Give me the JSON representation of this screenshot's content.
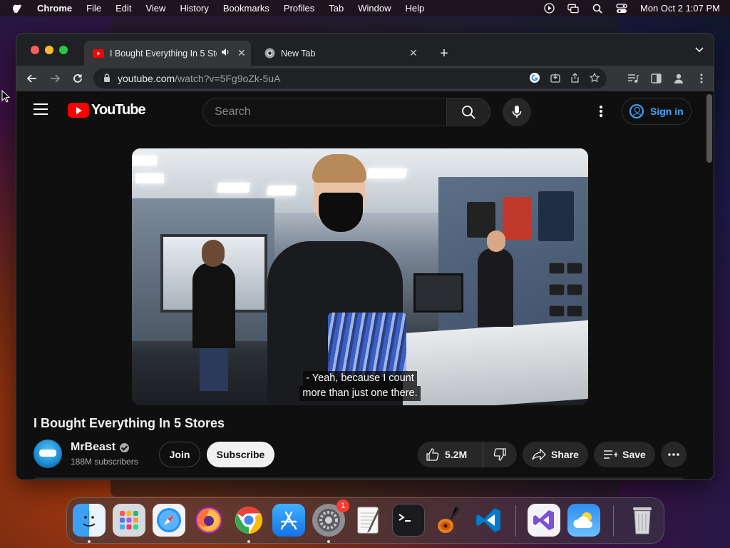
{
  "menubar": {
    "app_name": "Chrome",
    "items": [
      "File",
      "Edit",
      "View",
      "History",
      "Bookmarks",
      "Profiles",
      "Tab",
      "Window",
      "Help"
    ],
    "clock": "Mon Oct 2  1:07 PM"
  },
  "browser": {
    "tabs": [
      {
        "title": "I Bought Everything In 5 Sto",
        "favicon": "youtube-icon",
        "active": true
      },
      {
        "title": "New Tab",
        "favicon": "chrome-icon",
        "active": false
      }
    ],
    "url_host": "youtube.com",
    "url_path": "/watch?v=5Fg9oZk-5uA"
  },
  "youtube": {
    "logo_text": "YouTube",
    "search_placeholder": "Search",
    "sign_in_label": "Sign in",
    "caption_line1": "- Yeah, because I count",
    "caption_line2": "more than just one there.",
    "video_title": "I Bought Everything In 5 Stores",
    "channel_name": "MrBeast",
    "subscribers": "188M subscribers",
    "join_label": "Join",
    "subscribe_label": "Subscribe",
    "likes": "5.2M",
    "share_label": "Share",
    "save_label": "Save"
  },
  "dock": {
    "apps": [
      "finder-icon",
      "launchpad-icon",
      "safari-icon",
      "firefox-icon",
      "chrome-icon",
      "app-store-icon",
      "system-settings-icon",
      "textedit-icon",
      "terminal-icon",
      "garageband-icon",
      "vscode-icon",
      "visual-studio-icon",
      "weather-icon",
      "trash-icon"
    ],
    "settings_badge": "1"
  },
  "colors": {
    "youtube_red": "#ff0000",
    "link_blue": "#3ea6ff",
    "page_bg": "#0f0f0f"
  }
}
